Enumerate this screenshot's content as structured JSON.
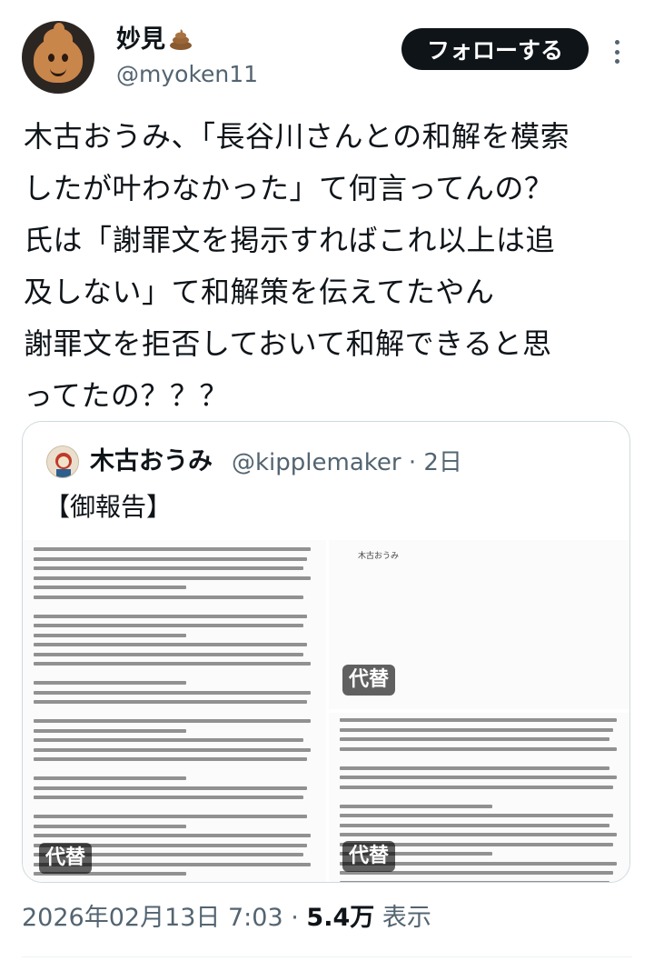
{
  "author": {
    "display_name": "妙見",
    "name_emoji": "poop-emoji",
    "handle": "@myoken11",
    "avatar_icon": "poop-avatar-icon"
  },
  "actions": {
    "follow_label": "フォローする",
    "more_icon": "more-dots-icon"
  },
  "tweet": {
    "text": "木古おうみ、「長谷川さんとの和解を模索\nしたが叶わなかった」て何言ってんの？\n氏は「謝罪文を掲示すればこれ以上は追\n及しない」て和解策を伝えてたやん\n謝罪文を拒否しておいて和解できると思\nってたの？？？"
  },
  "quote": {
    "display_name": "木古おうみ",
    "handle": "@kipplemaker",
    "separator": "·",
    "time": "2日",
    "text": "【御報告】",
    "doc_author": "木古おうみ",
    "alt_labels": [
      "代替",
      "代替",
      "代替"
    ]
  },
  "footer": {
    "timestamp": "2026年02月13日 7:03",
    "separator": "·",
    "views_count": "5.4万",
    "views_label": "表示"
  },
  "colors": {
    "text": "#0f1419",
    "secondary": "#536471",
    "follow_bg": "#0f1419",
    "border": "#cfd9de"
  }
}
